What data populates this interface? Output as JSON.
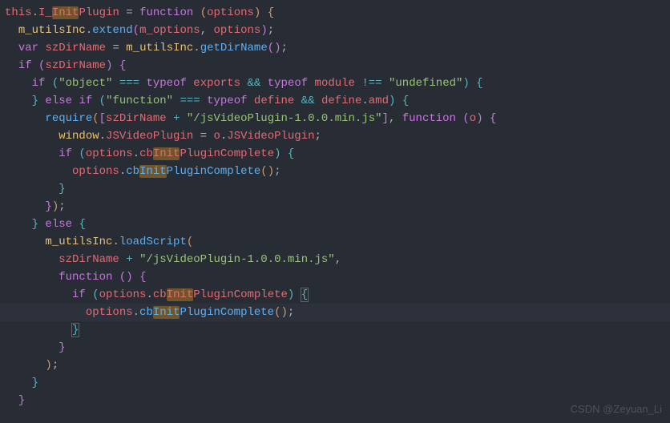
{
  "watermark": "CSDN @Zeyuan_Li",
  "code": {
    "l1": {
      "this": "this",
      "dot": ".",
      "prop": "I_",
      "hl": "Init",
      "prop2": "Plugin",
      "eq": " = ",
      "fn": "function",
      "sp": " ",
      "po": "(",
      "arg": "options",
      "pc": ")",
      "sp2": " ",
      "ob": "{"
    },
    "l2": {
      "indent": "  ",
      "obj": "m_utilsInc",
      "dot": ".",
      "fn": "extend",
      "po": "(",
      "a1": "m_options",
      "comma": ", ",
      "a2": "options",
      "pc": ")",
      ";": ";"
    },
    "l3": {
      "indent": "  ",
      "var": "var",
      "sp": " ",
      "name": "szDirName",
      "eq": " = ",
      "obj": "m_utilsInc",
      "dot": ".",
      "fn": "getDirName",
      "po": "(",
      "pc": ")",
      ";": ";"
    },
    "l4": {
      "indent": "  ",
      "if": "if",
      "sp": " ",
      "po": "(",
      "v": "szDirName",
      "pc": ")",
      "sp2": " ",
      "ob": "{"
    },
    "l5": {
      "indent": "    ",
      "if": "if",
      "sp": " ",
      "po": "(",
      "s1": "\"object\"",
      "eq": " === ",
      "tof": "typeof",
      "sp2": " ",
      "ex": "exports",
      "and": " && ",
      "tof2": "typeof",
      "sp3": " ",
      "mod": "module",
      "neq": " !== ",
      "s2": "\"undefined\"",
      "pc": ")",
      "sp4": " ",
      "ob": "{"
    },
    "l6": {
      "indent": "    ",
      "cb": "}",
      "sp": " ",
      "else": "else",
      "sp2": " ",
      "if": "if",
      "sp3": " ",
      "po": "(",
      "s1": "\"function\"",
      "eq": " === ",
      "tof": "typeof",
      "sp4": " ",
      "def": "define",
      "and": " && ",
      "def2": "define",
      "dot": ".",
      "amd": "amd",
      "pc": ")",
      "sp5": " ",
      "ob": "{"
    },
    "l7": {
      "indent": "      ",
      "fn": "require",
      "po": "(",
      "bo": "[",
      "v": "szDirName",
      "plus": " + ",
      "s": "\"/jsVideoPlugin-1.0.0.min.js\"",
      "bc": "]",
      "comma": ", ",
      "fnc": "function",
      "sp": " ",
      "po2": "(",
      "arg": "o",
      "pc2": ")",
      "sp2": " ",
      "ob": "{"
    },
    "l8": {
      "indent": "        ",
      "win": "window",
      "dot": ".",
      "prop": "JSVideoPlugin",
      "eq": " = ",
      "o": "o",
      "dot2": ".",
      "prop2": "JSVideoPlugin",
      "semi": ";"
    },
    "l9": {
      "indent": "        ",
      "if": "if",
      "sp": " ",
      "po": "(",
      "obj": "options",
      "dot": ".",
      "cb": "cb",
      "hl": "Init",
      "rest": "PluginComplete",
      "pc": ")",
      "sp2": " ",
      "ob": "{"
    },
    "l10": {
      "indent": "          ",
      "obj": "options",
      "dot": ".",
      "cb": "cb",
      "hl": "Init",
      "rest": "PluginComplete",
      "po": "(",
      "pc": ")",
      ";": ";"
    },
    "l11": {
      "indent": "        ",
      "cb": "}"
    },
    "l12": {
      "indent": "      ",
      "cb": "}",
      "pc": ")",
      ";": ";"
    },
    "l13": {
      "indent": "    ",
      "cb": "}",
      "sp": " ",
      "else": "else",
      "sp2": " ",
      "ob": "{"
    },
    "l14": {
      "indent": "      ",
      "obj": "m_utilsInc",
      "dot": ".",
      "fn": "loadScript",
      "po": "("
    },
    "l15": {
      "indent": "        ",
      "v": "szDirName",
      "plus": " + ",
      "s": "\"/jsVideoPlugin-1.0.0.min.js\"",
      "comma": ","
    },
    "l16": {
      "indent": "        ",
      "fn": "function",
      "sp": " ",
      "po": "(",
      "pc": ")",
      "sp2": " ",
      "ob": "{"
    },
    "l17": {
      "indent": "          ",
      "if": "if",
      "sp": " ",
      "po": "(",
      "obj": "options",
      "dot": ".",
      "cb": "cb",
      "hl": "Init",
      "rest": "PluginComplete",
      "pc": ")",
      "sp2": " ",
      "ob": "{"
    },
    "l18": {
      "indent": "            ",
      "obj": "options",
      "dot": ".",
      "cb": "cb",
      "hl": "Init",
      "rest": "PluginComplete",
      "po": "(",
      "pc": ")",
      ";": ";"
    },
    "l19": {
      "indent": "          ",
      "cb": "}"
    },
    "l20": {
      "indent": "        ",
      "cb": "}"
    },
    "l21": {
      "indent": "      ",
      "pc": ")",
      ";": ";"
    },
    "l22": {
      "indent": "    ",
      "cb": "}"
    },
    "l23": {
      "indent": "  ",
      "cb": "}"
    }
  }
}
